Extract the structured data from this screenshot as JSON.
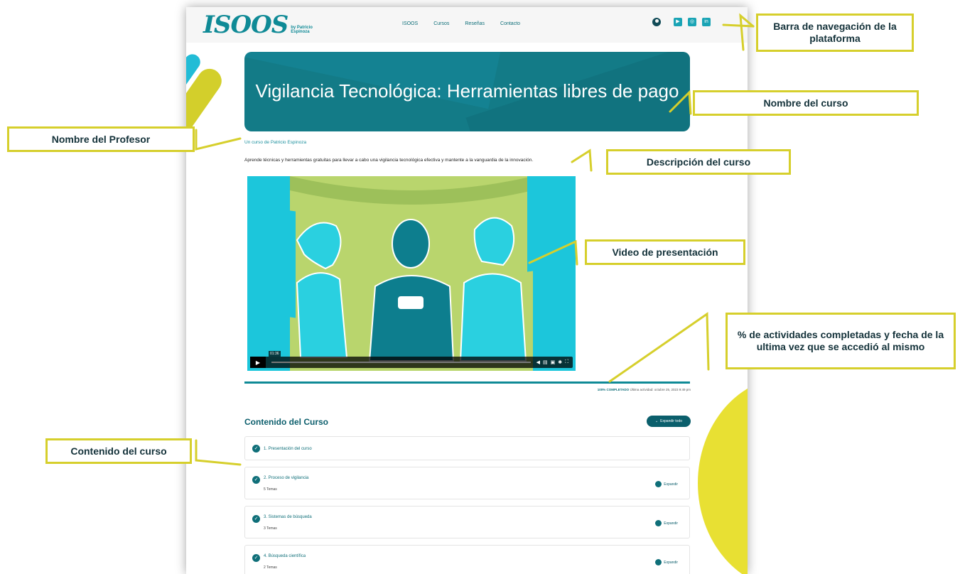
{
  "nav": {
    "logo_text": "ISOOS",
    "logo_by_line1": "by Patricio",
    "logo_by_line2": "Espinoza",
    "links": [
      "ISOOS",
      "Cursos",
      "Reseñas",
      "Contacto"
    ],
    "icons": [
      "user-icon",
      "youtube-icon",
      "instagram-icon",
      "linkedin-icon"
    ]
  },
  "course": {
    "title": "Vigilancia Tecnológica: Herramientas libres de pago",
    "teacher_line": "Un curso de Patricio Espinoza",
    "description": "Aprende técnicas y herramientas gratuitas para llevar a cabo una vigilancia tecnológica efectiva y mantente a la vanguardia de la innovación.",
    "video_time": "01:36",
    "progress_percent": 100,
    "progress_label": "100% COMPLETADO",
    "last_activity": "Última actividad: octubre 25, 2023 9:49 pm"
  },
  "content": {
    "section_title": "Contenido del Curso",
    "expand_all": "Expandir todo",
    "expand_label": "Expandir",
    "lessons": [
      {
        "title": "1. Presentación del curso",
        "count": ""
      },
      {
        "title": "2. Proceso de vigilancia",
        "count": "5 Temas"
      },
      {
        "title": "3. Sistemas de búsqueda",
        "count": "3 Temas"
      },
      {
        "title": "4. Búsqueda científica",
        "count": "2 Temas"
      }
    ]
  },
  "annotations": {
    "navbar": "Barra de navegación de la plataforma",
    "course_name": "Nombre del curso",
    "teacher_name": "Nombre del Profesor",
    "description": "Descripción del curso",
    "video": "Video de presentación",
    "progress": "% de actividades completadas y fecha de la ultima vez que se accedió al mismo",
    "content": "Contenido del curso"
  },
  "colors": {
    "accent_teal": "#0f8a96",
    "dark_teal": "#0b5f6c",
    "annotation_border": "#d6cf2c",
    "decor_yellow": "#e8e033"
  }
}
